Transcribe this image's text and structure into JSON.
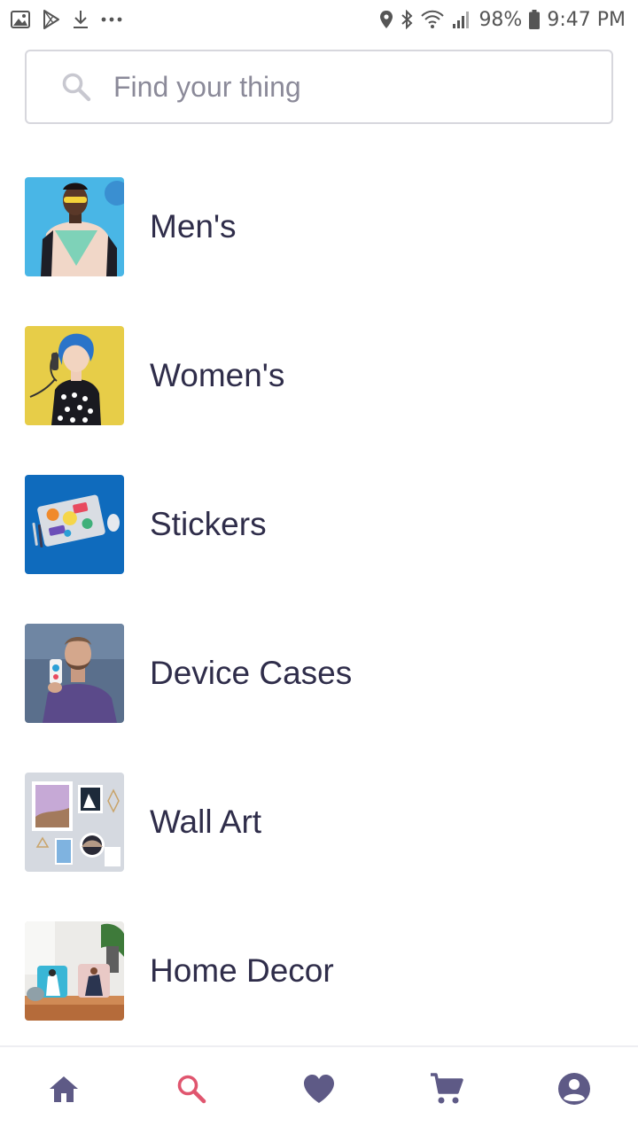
{
  "status_bar": {
    "battery": "98%",
    "time": "9:47 PM",
    "icons_left": [
      "image-icon",
      "play-store-icon",
      "download-icon",
      "more-icon"
    ],
    "icons_right": [
      "location-icon",
      "bluetooth-icon",
      "wifi-icon",
      "signal-icon",
      "battery-icon"
    ]
  },
  "search": {
    "placeholder": "Find your thing",
    "value": ""
  },
  "categories": [
    {
      "label": "Men's",
      "thumb": "mens-thumbnail"
    },
    {
      "label": "Women's",
      "thumb": "womens-thumbnail"
    },
    {
      "label": "Stickers",
      "thumb": "stickers-thumbnail"
    },
    {
      "label": "Device Cases",
      "thumb": "device-cases-thumbnail"
    },
    {
      "label": "Wall Art",
      "thumb": "wall-art-thumbnail"
    },
    {
      "label": "Home Decor",
      "thumb": "home-decor-thumbnail"
    }
  ],
  "bottom_nav": {
    "items": [
      "home-icon",
      "search-icon",
      "heart-icon",
      "cart-icon",
      "account-icon"
    ],
    "active": "search-icon"
  },
  "colors": {
    "text": "#2f2d4a",
    "nav_icon": "#5e5a86",
    "nav_active": "#e0566f",
    "search_border": "#d7d7dd",
    "placeholder": "#8b8a99"
  }
}
